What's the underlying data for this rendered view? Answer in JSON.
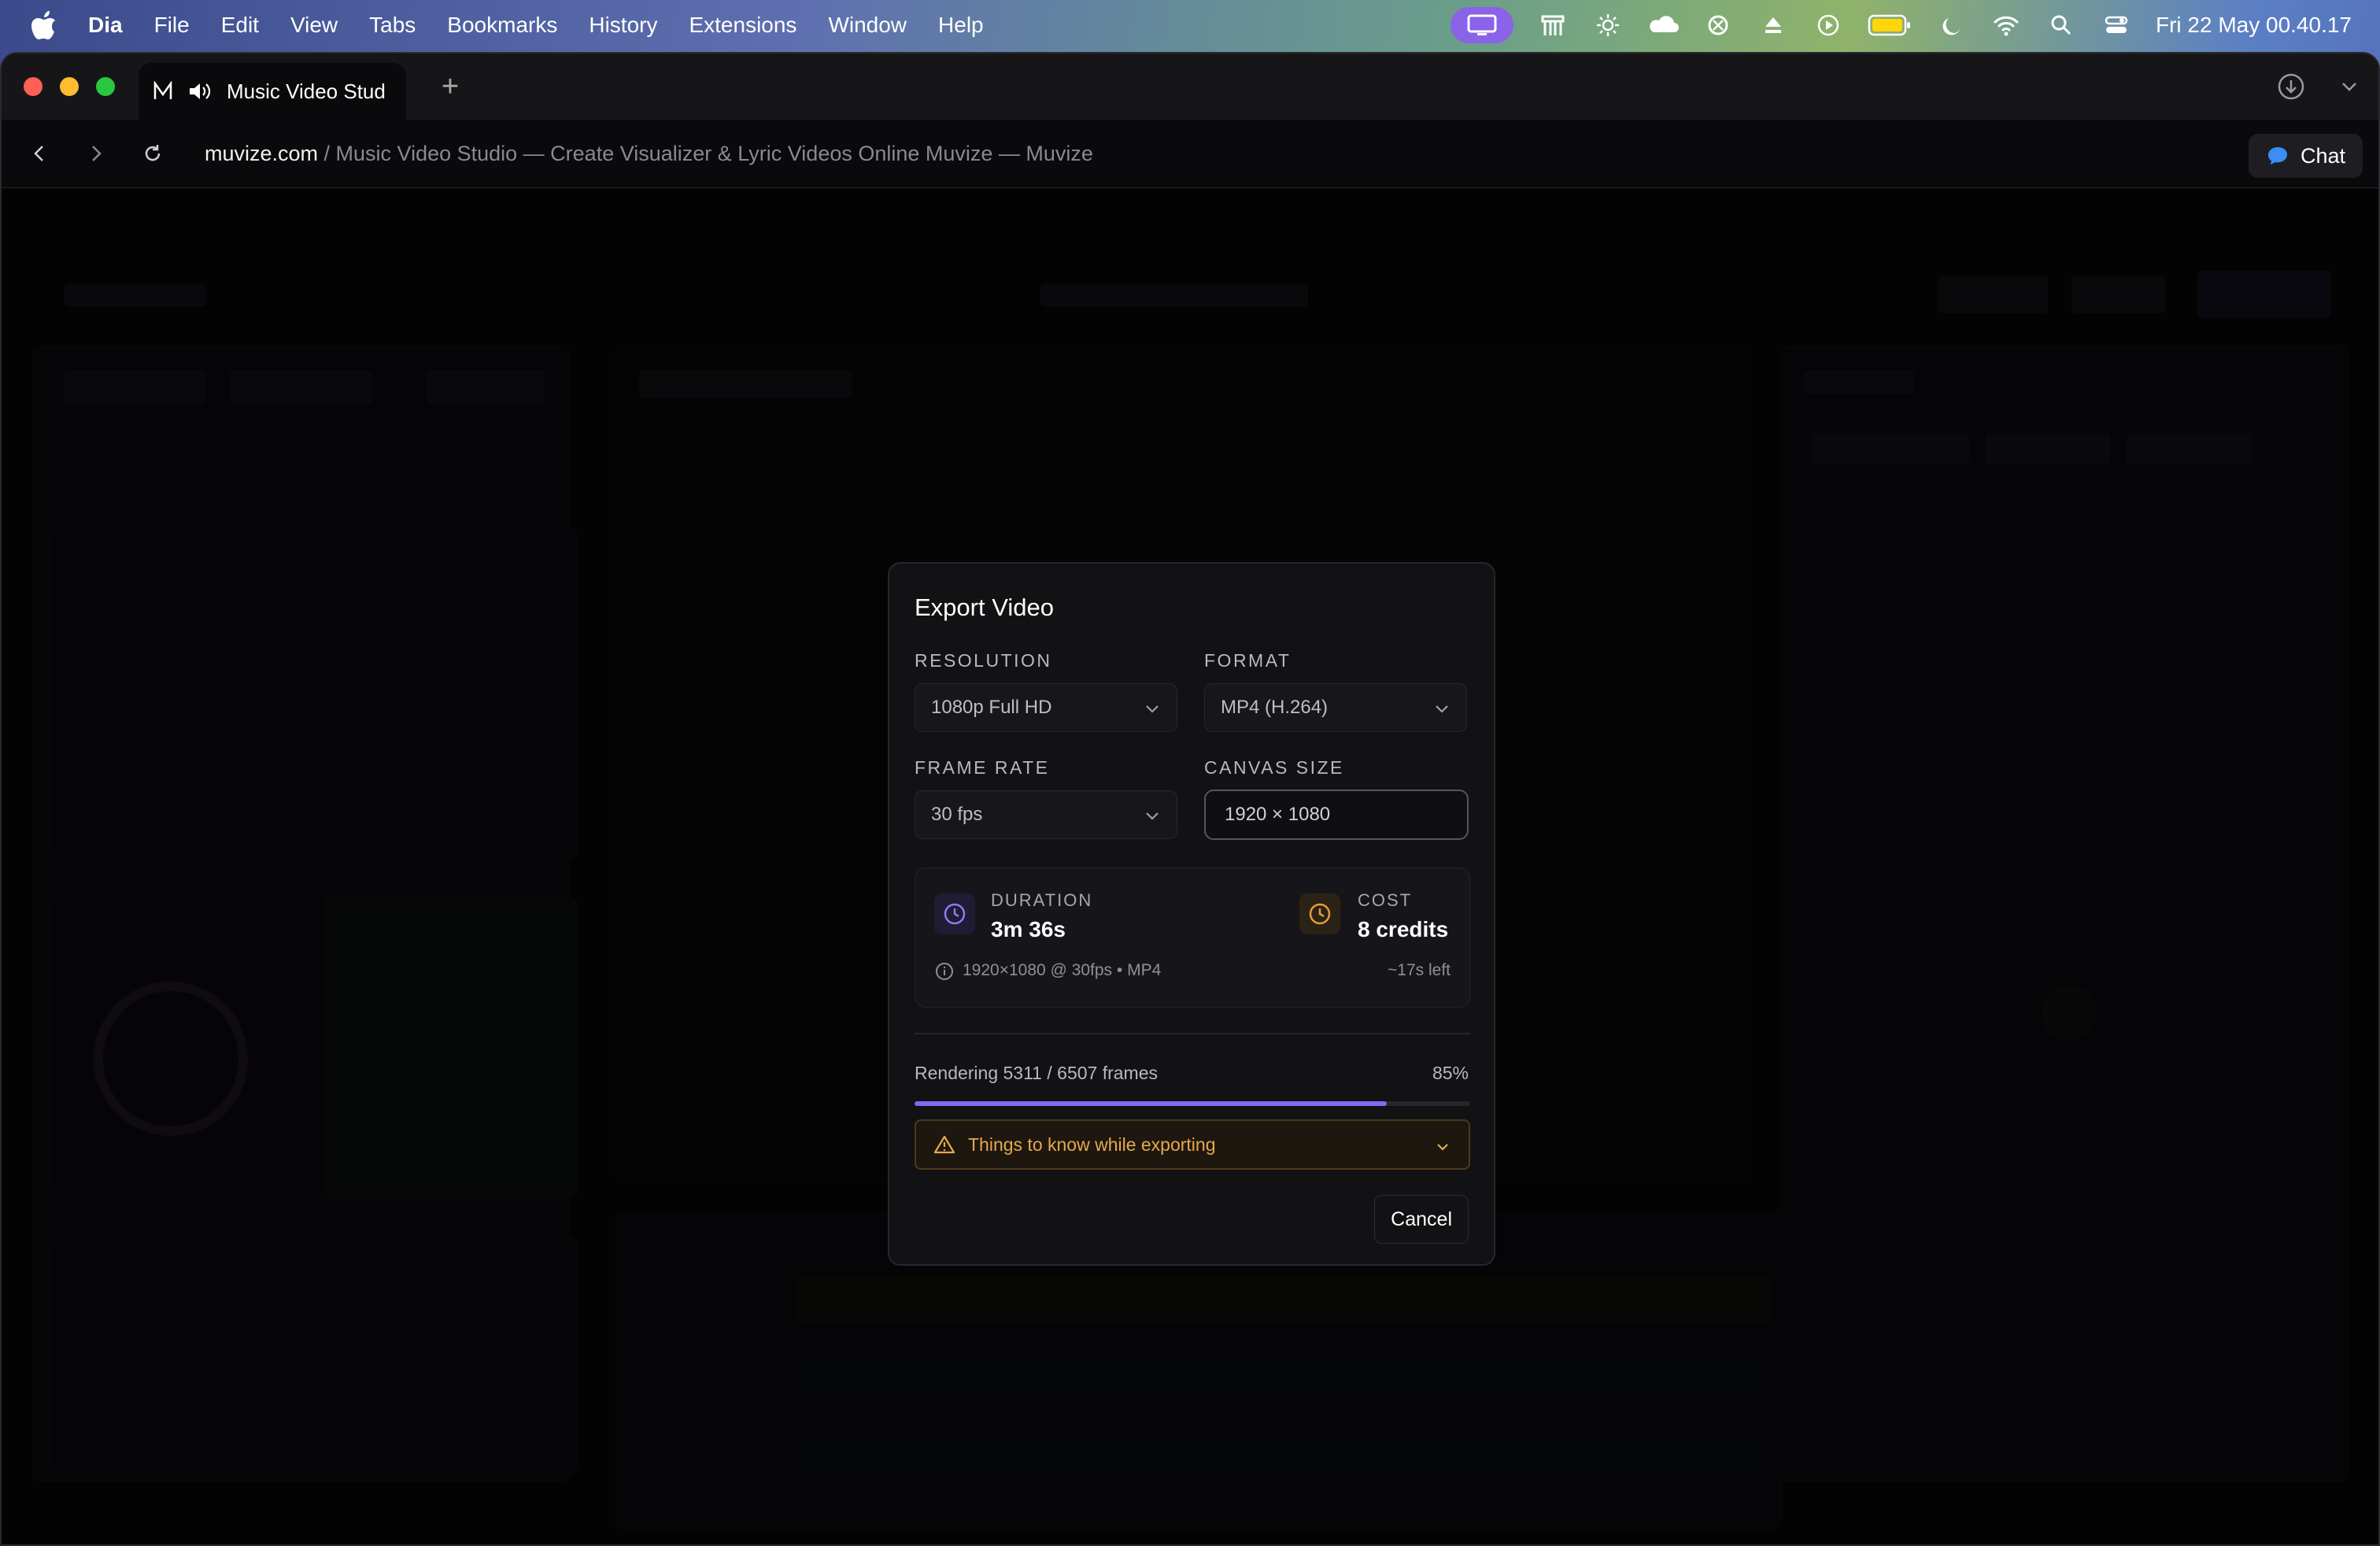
{
  "menubar": {
    "app_name": "Dia",
    "items": [
      "File",
      "Edit",
      "View",
      "Tabs",
      "Bookmarks",
      "History",
      "Extensions",
      "Window",
      "Help"
    ],
    "datetime": "Fri 22 May  00.40.17"
  },
  "browser": {
    "tab_title": "Music Video Stud",
    "url_host": "muvize.com",
    "url_rest": " / Music Video Studio — Create Visualizer & Lyric Videos Online Muvize — Muvize",
    "chat_label": "Chat"
  },
  "modal": {
    "title": "Export Video",
    "resolution_label": "RESOLUTION",
    "resolution_value": "1080p Full HD",
    "format_label": "FORMAT",
    "format_value": "MP4 (H.264)",
    "frame_rate_label": "FRAME RATE",
    "frame_rate_value": "30 fps",
    "canvas_size_label": "CANVAS SIZE",
    "canvas_size_value": "1920 × 1080",
    "duration_label": "DURATION",
    "duration_value": "3m 36s",
    "cost_label": "COST",
    "cost_value": "8 credits",
    "spec_summary": "1920×1080 @ 30fps • MP4",
    "time_left": "~17s left",
    "progress_text": "Rendering 5311 / 6507 frames",
    "progress_percent_label": "85%",
    "progress_fraction": 0.85,
    "warning_text": "Things to know while exporting",
    "cancel_label": "Cancel"
  },
  "colors": {
    "accent": "#7c6af2",
    "warning": "#e8a84a",
    "cost_icon": "#e89a3c"
  }
}
